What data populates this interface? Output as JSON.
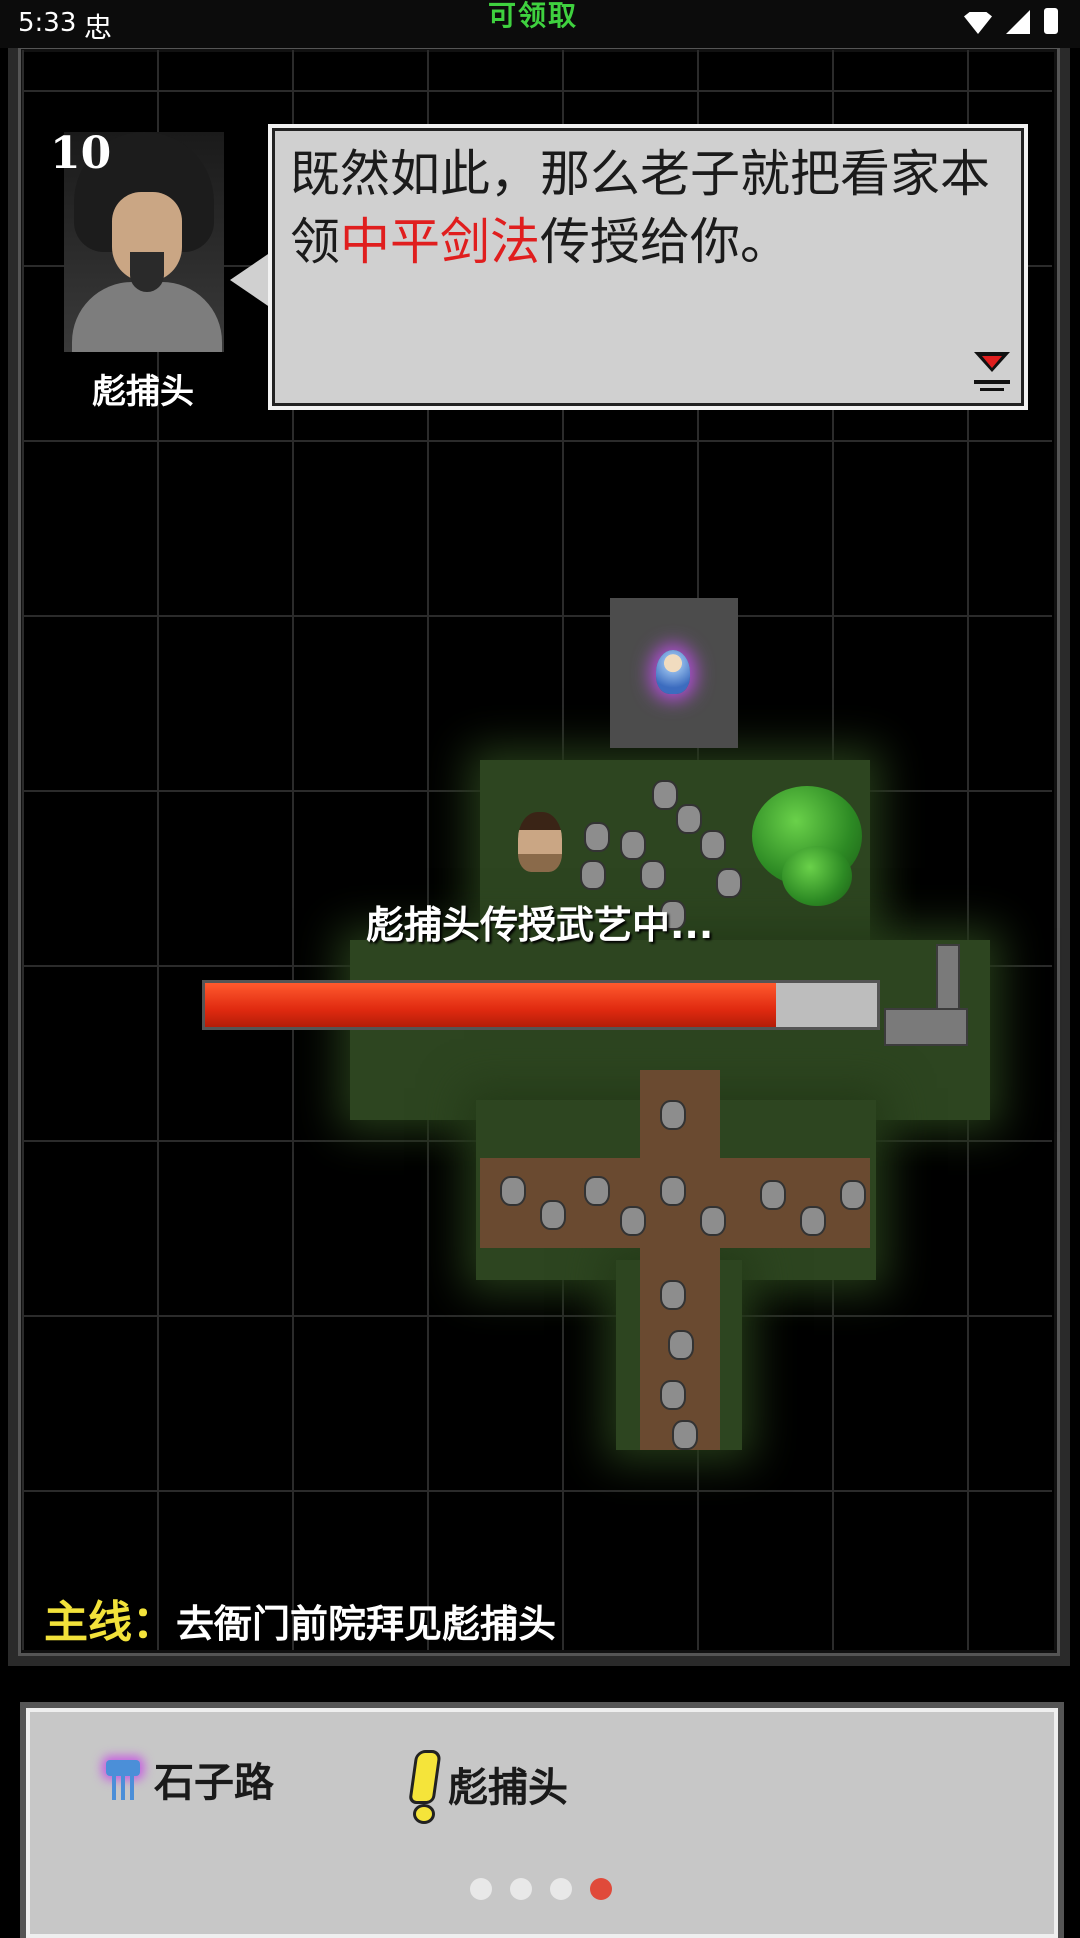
{
  "status_bar": {
    "time": "5:33",
    "debug_glyph": "忠",
    "top_banner": "可领取",
    "icons": [
      "wifi-icon",
      "signal-icon",
      "battery-icon"
    ]
  },
  "dialog": {
    "level": "10",
    "speaker_name": "彪捕头",
    "text_before": "既然如此，那么老子就把看家本领",
    "text_highlight": "中平剑法",
    "text_after": "传授给你。",
    "highlight_color": "#e01e1e"
  },
  "progress": {
    "label": "彪捕头传授武艺中...",
    "fraction": 0.85
  },
  "quest": {
    "label": "主线：",
    "text": "去衙门前院拜见彪捕头"
  },
  "panel": {
    "items": [
      {
        "icon": "road-icon",
        "label": "石子路"
      },
      {
        "icon": "exclamation-icon",
        "label": "彪捕头"
      }
    ]
  },
  "pager": {
    "count": 4,
    "active_index": 3
  }
}
